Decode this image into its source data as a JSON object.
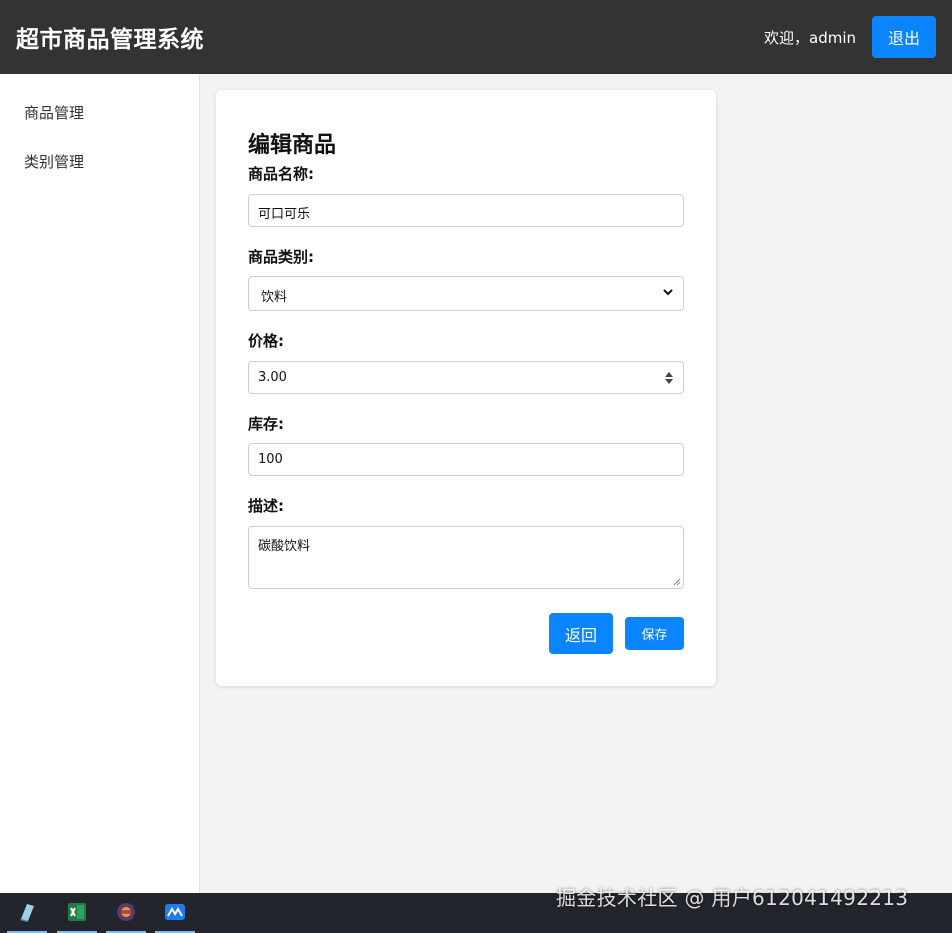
{
  "header": {
    "app_title": "超市商品管理系统",
    "welcome_text": "欢迎，admin",
    "logout_label": "退出"
  },
  "sidebar": {
    "items": [
      {
        "label": "商品管理"
      },
      {
        "label": "类别管理"
      }
    ]
  },
  "form": {
    "title": "编辑商品",
    "name_label": "商品名称:",
    "name_value": "可口可乐",
    "category_label": "商品类别:",
    "category_value": "饮料",
    "price_label": "价格:",
    "price_value": "3.00",
    "stock_label": "库存:",
    "stock_value": "100",
    "desc_label": "描述:",
    "desc_value": "碳酸饮料",
    "back_label": "返回",
    "save_label": "保存"
  },
  "colors": {
    "header_bg": "#333333",
    "accent": "#0a84ff",
    "page_bg": "#f3f3f3"
  },
  "taskbar": {
    "apps": [
      "notepad-icon",
      "excel-icon",
      "game-icon",
      "app-icon"
    ]
  },
  "watermark": "掘金技术社区 @ 用户612041492213"
}
